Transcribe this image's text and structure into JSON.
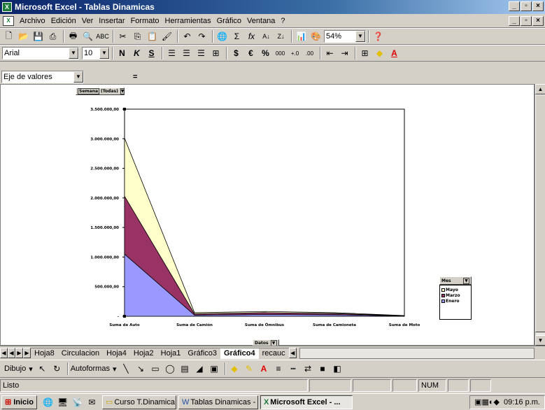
{
  "window": {
    "title": "Microsoft Excel - Tablas Dinamicas"
  },
  "menu": [
    "Archivo",
    "Edición",
    "Ver",
    "Insertar",
    "Formato",
    "Herramientas",
    "Gráfico",
    "Ventana",
    "?"
  ],
  "toolbar": {
    "zoom": "54%",
    "font": "Arial",
    "font_size": "10"
  },
  "formula_bar": {
    "name_box": "Eje de valores",
    "equals": "="
  },
  "pivot": {
    "page_field": "Semana",
    "page_value": "(Todas)",
    "data_field": "Datos",
    "series_field": "Mes"
  },
  "chart_data": {
    "type": "area",
    "stacked": true,
    "categories": [
      "Suma de Auto",
      "Suma de Camión",
      "Suma de Ómnibus",
      "Suma de Camioneta",
      "Suma de Moto"
    ],
    "ylim": [
      0,
      3500000
    ],
    "yticks": [
      "-",
      "500.000,00",
      "1.000.000,00",
      "1.500.000,00",
      "2.000.000,00",
      "2.500.000,00",
      "3.000.000,00",
      "3.500.000,00"
    ],
    "legend_position": "right",
    "series": [
      {
        "name": "Enero",
        "color": "#9999ff",
        "values": [
          1050000,
          20000,
          30000,
          25000,
          5000
        ]
      },
      {
        "name": "Marzo",
        "color": "#993366",
        "values": [
          980000,
          20000,
          30000,
          20000,
          4000
        ]
      },
      {
        "name": "Mayo",
        "color": "#ffffcc",
        "values": [
          980000,
          20000,
          20000,
          15000,
          3000
        ]
      }
    ]
  },
  "sheet_tabs": [
    "Hoja8",
    "Circulacion",
    "Hoja4",
    "Hoja2",
    "Hoja1",
    "Gráfico3",
    "Gráfico4",
    "recauc"
  ],
  "active_tab": "Gráfico4",
  "drawbar": {
    "dibujo": "Dibujo",
    "autoformas": "Autoformas"
  },
  "status": {
    "text": "Listo",
    "num": "NUM"
  },
  "taskbar": {
    "start": "Inicio",
    "tasks": [
      "Curso T.Dinamica Exc...",
      "Tablas Dinamicas - Mi...",
      "Microsoft Excel - ..."
    ],
    "clock": "09:16 p.m."
  }
}
